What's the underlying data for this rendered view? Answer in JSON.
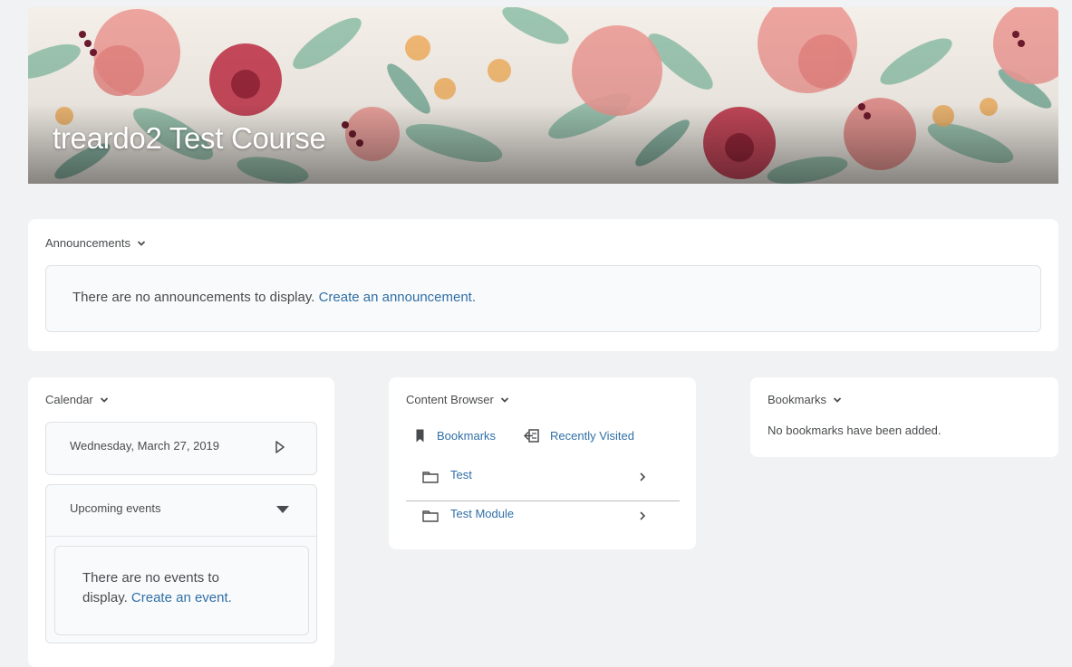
{
  "course": {
    "title": "treardo2 Test Course"
  },
  "announcements": {
    "title": "Announcements",
    "empty_text": "There are no announcements to display.",
    "create_link": "Create an announcement."
  },
  "calendar": {
    "title": "Calendar",
    "date": "Wednesday, March 27, 2019",
    "upcoming_label": "Upcoming events",
    "empty_text_line1": "There are no events to",
    "empty_text_line2": "display.",
    "create_link": "Create an event."
  },
  "content_browser": {
    "title": "Content Browser",
    "bookmarks_label": "Bookmarks",
    "recent_label": "Recently Visited",
    "items": [
      {
        "label": "Test"
      },
      {
        "label": "Test Module"
      }
    ]
  },
  "bookmarks": {
    "title": "Bookmarks",
    "empty_text": "No bookmarks have been added."
  },
  "colors": {
    "link": "#2f6fa7",
    "text": "#494c4e",
    "page_bg": "#f1f2f4"
  }
}
